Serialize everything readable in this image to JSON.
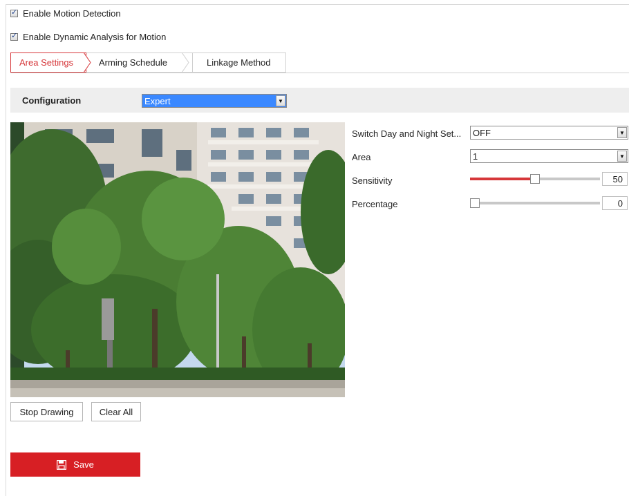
{
  "options": {
    "enable_motion_detection": {
      "label": "Enable Motion Detection",
      "checked": true
    },
    "enable_dynamic_analysis": {
      "label": "Enable Dynamic Analysis for Motion",
      "checked": true
    }
  },
  "tabs": [
    {
      "label": "Area Settings",
      "active": true
    },
    {
      "label": "Arming Schedule",
      "active": false
    },
    {
      "label": "Linkage Method",
      "active": false
    }
  ],
  "configuration": {
    "label": "Configuration",
    "value": "Expert"
  },
  "settings": {
    "switch_day_night": {
      "label": "Switch Day and Night Set...",
      "value": "OFF"
    },
    "area": {
      "label": "Area",
      "value": "1"
    },
    "sensitivity": {
      "label": "Sensitivity",
      "value": "50",
      "level": 0.5
    },
    "percentage": {
      "label": "Percentage",
      "value": "0",
      "level": 0.0
    }
  },
  "drawing": {
    "stop_label": "Stop Drawing",
    "clear_label": "Clear All"
  },
  "save": {
    "label": "Save",
    "icon": "save-icon"
  },
  "colors": {
    "accent": "#d71f24",
    "tab_active": "#d6373a",
    "select_highlight": "#3a88ff"
  }
}
